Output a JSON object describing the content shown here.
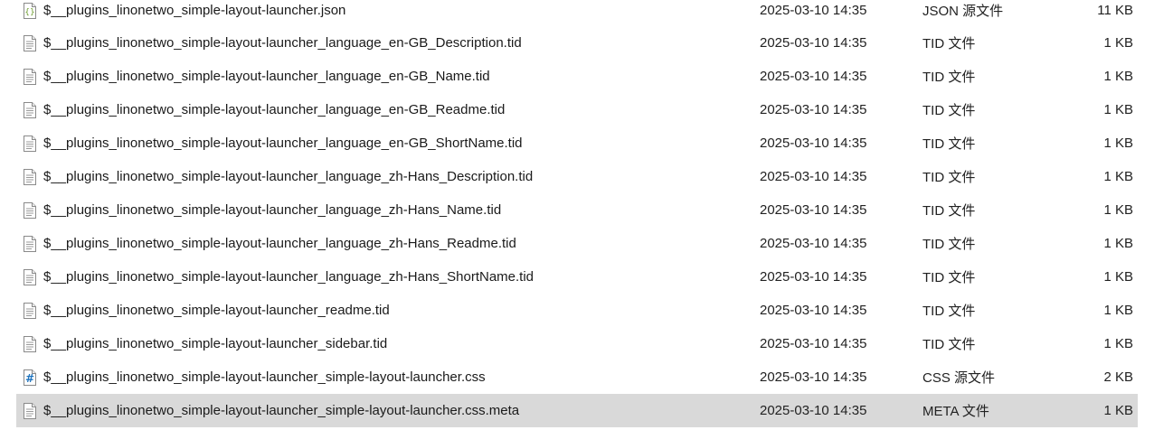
{
  "files": [
    {
      "name": "$__plugins_linonetwo_simple-layout-launcher.json",
      "date": "2025-03-10 14:35",
      "type": "JSON 源文件",
      "size": "11 KB",
      "icon": "json-file-icon"
    },
    {
      "name": "$__plugins_linonetwo_simple-layout-launcher_language_en-GB_Description.tid",
      "date": "2025-03-10 14:35",
      "type": "TID 文件",
      "size": "1 KB",
      "icon": "text-file-icon"
    },
    {
      "name": "$__plugins_linonetwo_simple-layout-launcher_language_en-GB_Name.tid",
      "date": "2025-03-10 14:35",
      "type": "TID 文件",
      "size": "1 KB",
      "icon": "text-file-icon"
    },
    {
      "name": "$__plugins_linonetwo_simple-layout-launcher_language_en-GB_Readme.tid",
      "date": "2025-03-10 14:35",
      "type": "TID 文件",
      "size": "1 KB",
      "icon": "text-file-icon"
    },
    {
      "name": "$__plugins_linonetwo_simple-layout-launcher_language_en-GB_ShortName.tid",
      "date": "2025-03-10 14:35",
      "type": "TID 文件",
      "size": "1 KB",
      "icon": "text-file-icon"
    },
    {
      "name": "$__plugins_linonetwo_simple-layout-launcher_language_zh-Hans_Description.tid",
      "date": "2025-03-10 14:35",
      "type": "TID 文件",
      "size": "1 KB",
      "icon": "text-file-icon"
    },
    {
      "name": "$__plugins_linonetwo_simple-layout-launcher_language_zh-Hans_Name.tid",
      "date": "2025-03-10 14:35",
      "type": "TID 文件",
      "size": "1 KB",
      "icon": "text-file-icon"
    },
    {
      "name": "$__plugins_linonetwo_simple-layout-launcher_language_zh-Hans_Readme.tid",
      "date": "2025-03-10 14:35",
      "type": "TID 文件",
      "size": "1 KB",
      "icon": "text-file-icon"
    },
    {
      "name": "$__plugins_linonetwo_simple-layout-launcher_language_zh-Hans_ShortName.tid",
      "date": "2025-03-10 14:35",
      "type": "TID 文件",
      "size": "1 KB",
      "icon": "text-file-icon"
    },
    {
      "name": "$__plugins_linonetwo_simple-layout-launcher_readme.tid",
      "date": "2025-03-10 14:35",
      "type": "TID 文件",
      "size": "1 KB",
      "icon": "text-file-icon"
    },
    {
      "name": "$__plugins_linonetwo_simple-layout-launcher_sidebar.tid",
      "date": "2025-03-10 14:35",
      "type": "TID 文件",
      "size": "1 KB",
      "icon": "text-file-icon"
    },
    {
      "name": "$__plugins_linonetwo_simple-layout-launcher_simple-layout-launcher.css",
      "date": "2025-03-10 14:35",
      "type": "CSS 源文件",
      "size": "2 KB",
      "icon": "css-file-icon"
    },
    {
      "name": "$__plugins_linonetwo_simple-layout-launcher_simple-layout-launcher.css.meta",
      "date": "2025-03-10 14:35",
      "type": "META 文件",
      "size": "1 KB",
      "icon": "text-file-icon",
      "selected": true
    }
  ],
  "colors": {
    "selected_row": "#d9d9d9",
    "css_icon": "#1e73be",
    "json_icon": "#6a9a2a"
  }
}
